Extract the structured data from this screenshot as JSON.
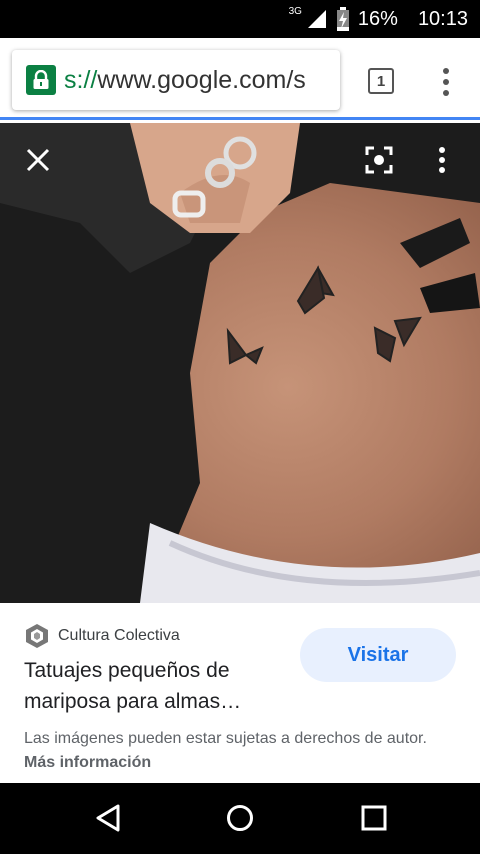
{
  "status_bar": {
    "network": "3G",
    "battery": "16%",
    "time": "10:13"
  },
  "toolbar": {
    "url_scheme_fragment": "s://",
    "url_text": "www.google.com/s",
    "tab_count": "1"
  },
  "viewer": {
    "icons": [
      "close-icon",
      "lens-icon",
      "more-vert-icon"
    ]
  },
  "result": {
    "source_name": "Cultura Colectiva",
    "title": "Tatuajes pequeños de mariposa para almas…",
    "visit_label": "Visitar",
    "copyright_text": "Las imágenes pueden estar sujetas a derechos de autor.",
    "more_info": "Más información"
  },
  "navbar": {
    "icons": [
      "back-icon",
      "home-icon",
      "recents-icon"
    ]
  },
  "colors": {
    "accent": "#1a73e8",
    "lock_green": "#0b8043",
    "progress_blue": "#4285f4"
  }
}
